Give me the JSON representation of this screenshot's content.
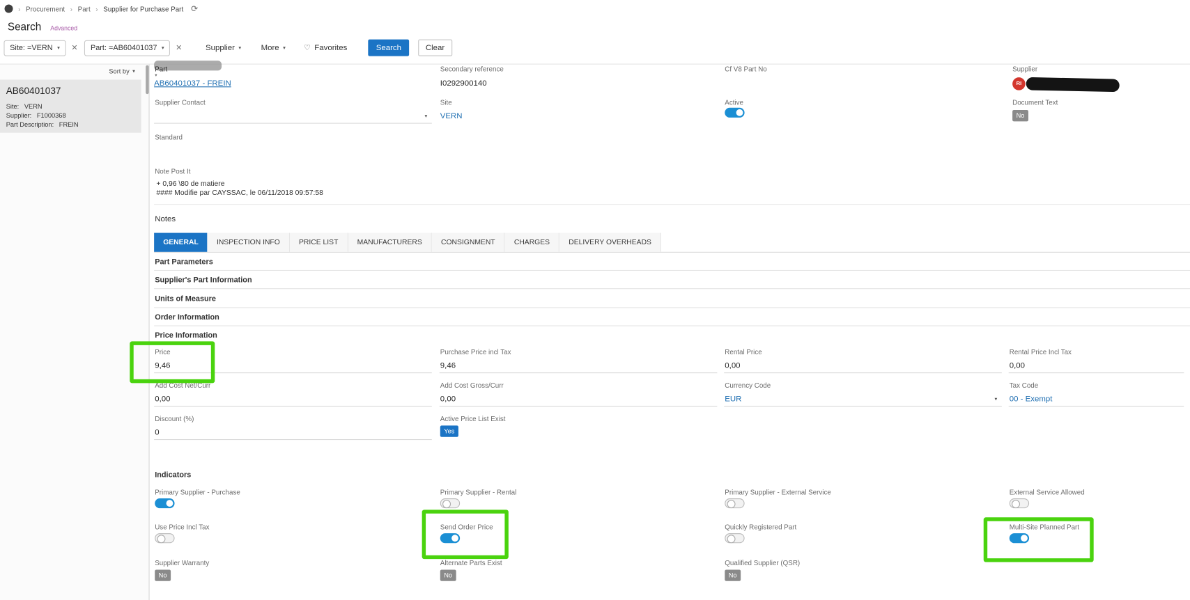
{
  "colors": {
    "accent_blue": "#1b74c5",
    "link_blue": "#1f6fb2",
    "toggle_on_blue": "#1b8fd4",
    "badge_gray": "#8a8a8a",
    "annotation_green": "#4ad30e",
    "avatar_red": "#d3362d"
  },
  "icons": {
    "chevron_right": "›",
    "refresh": "⟳",
    "close": "✕",
    "caret_down": "▾",
    "heart": "♡"
  },
  "topbar": {
    "breadcrumb": [
      "Procurement",
      "Part",
      "Supplier for Purchase Part"
    ]
  },
  "search_bar": {
    "title": "Search",
    "advanced": "Advanced",
    "site_filter": "Site: =VERN",
    "part_filter": "Part: =AB60401037",
    "supplier_dropdown": "Supplier",
    "more_dropdown": "More",
    "favorites": "Favorites",
    "search_button": "Search",
    "clear_button": "Clear"
  },
  "sidebar": {
    "sort_by": "Sort by",
    "selected_item": {
      "title": "AB60401037",
      "rows": [
        {
          "label": "Site:",
          "value": "VERN"
        },
        {
          "label": "Supplier:",
          "value": "F1000368"
        },
        {
          "label": "Part Description:",
          "value": "FREIN"
        }
      ]
    }
  },
  "record": {
    "part": {
      "label": "Part",
      "value": "AB60401037 - FREIN"
    },
    "secondary_reference": {
      "label": "Secondary reference",
      "value": "I0292900140"
    },
    "cf_v8_part_no": {
      "label": "Cf V8 Part No",
      "value": ""
    },
    "supplier": {
      "label": "Supplier",
      "avatar_initials": "RI",
      "name_redacted": true
    },
    "supplier_contact": {
      "label": "Supplier Contact",
      "value": ""
    },
    "site": {
      "label": "Site",
      "value": "VERN"
    },
    "active": {
      "label": "Active",
      "on": true
    },
    "document_text": {
      "label": "Document Text",
      "value": "No"
    },
    "standard": {
      "label": "Standard",
      "value": ""
    },
    "note_post_it": {
      "label": "Note Post It",
      "lines": [
        "+ 0,96 \\80 de matiere",
        "#### Modifie par CAYSSAC, le 06/11/2018 09:57:58"
      ]
    },
    "notes_label": "Notes"
  },
  "tabs": [
    {
      "label": "GENERAL",
      "active": true
    },
    {
      "label": "INSPECTION INFO",
      "active": false
    },
    {
      "label": "PRICE LIST",
      "active": false
    },
    {
      "label": "MANUFACTURERS",
      "active": false
    },
    {
      "label": "CONSIGNMENT",
      "active": false
    },
    {
      "label": "CHARGES",
      "active": false
    },
    {
      "label": "DELIVERY OVERHEADS",
      "active": false
    }
  ],
  "sections": {
    "part_parameters": "Part Parameters",
    "suppliers_part_information": "Supplier's Part Information",
    "units_of_measure": "Units of Measure",
    "order_information": "Order Information",
    "price_information": "Price Information",
    "indicators": "Indicators"
  },
  "price_information": {
    "price": {
      "label": "Price",
      "value": "9,46"
    },
    "purchase_price_incl_tax": {
      "label": "Purchase Price incl Tax",
      "value": "9,46"
    },
    "rental_price": {
      "label": "Rental Price",
      "value": "0,00"
    },
    "rental_price_incl_tax": {
      "label": "Rental Price Incl Tax",
      "value": "0,00"
    },
    "add_cost_net_curr": {
      "label": "Add Cost Net/Curr",
      "value": "0,00"
    },
    "add_cost_gross_curr": {
      "label": "Add Cost Gross/Curr",
      "value": "0,00"
    },
    "currency_code": {
      "label": "Currency Code",
      "value": "EUR"
    },
    "tax_code": {
      "label": "Tax Code",
      "value": "00 - Exempt"
    },
    "discount_pct": {
      "label": "Discount (%)",
      "value": "0"
    },
    "active_price_list_exist": {
      "label": "Active Price List Exist",
      "value": "Yes"
    }
  },
  "indicators": {
    "primary_supplier_purchase": {
      "label": "Primary Supplier - Purchase",
      "on": true
    },
    "primary_supplier_rental": {
      "label": "Primary Supplier - Rental",
      "on": false
    },
    "primary_supplier_external_service": {
      "label": "Primary Supplier - External Service",
      "on": false
    },
    "external_service_allowed": {
      "label": "External Service Allowed",
      "on": false
    },
    "use_price_incl_tax": {
      "label": "Use Price Incl Tax",
      "on": false
    },
    "send_order_price": {
      "label": "Send Order Price",
      "on": true
    },
    "quickly_registered_part": {
      "label": "Quickly Registered Part",
      "on": false
    },
    "multi_site_planned_part": {
      "label": "Multi-Site Planned Part",
      "on": true
    },
    "supplier_warranty": {
      "label": "Supplier Warranty",
      "value": "No"
    },
    "alternate_parts_exist": {
      "label": "Alternate Parts Exist",
      "value": "No"
    },
    "qualified_supplier_qsr": {
      "label": "Qualified Supplier (QSR)",
      "value": "No"
    }
  }
}
